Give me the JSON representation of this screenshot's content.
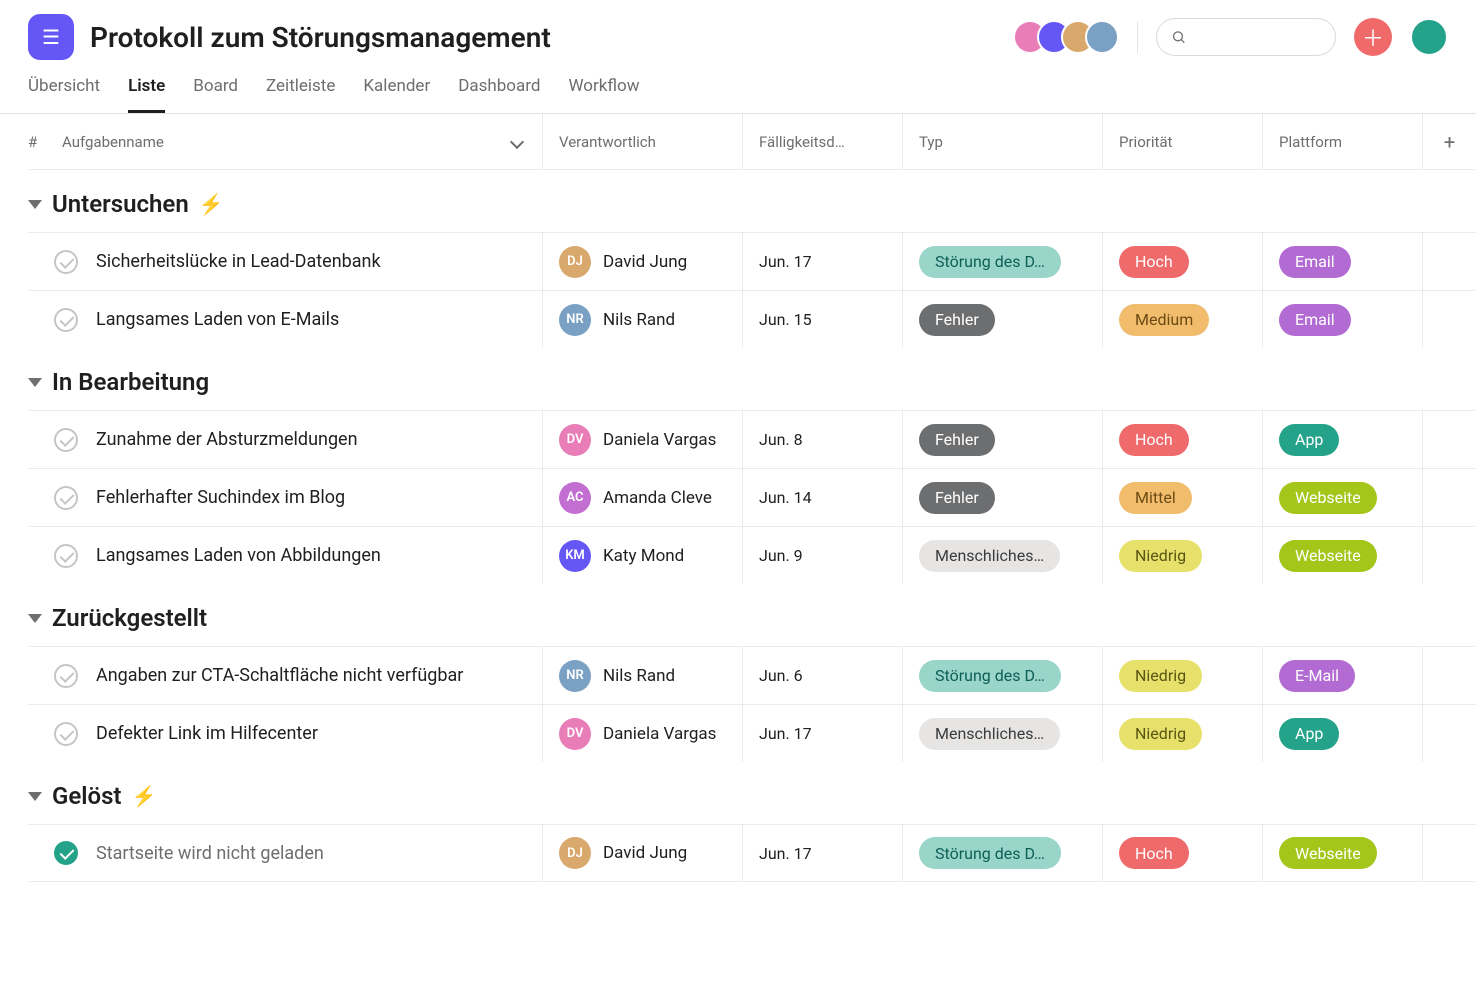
{
  "header": {
    "title": "Protokoll zum Störungsmanagement",
    "search_placeholder": ""
  },
  "tabs": [
    {
      "label": "Übersicht",
      "active": false
    },
    {
      "label": "Liste",
      "active": true
    },
    {
      "label": "Board",
      "active": false
    },
    {
      "label": "Zeitleiste",
      "active": false
    },
    {
      "label": "Kalender",
      "active": false
    },
    {
      "label": "Dashboard",
      "active": false
    },
    {
      "label": "Workflow",
      "active": false
    }
  ],
  "columns": {
    "hash": "#",
    "name": "Aufgabenname",
    "assignee": "Verantwortlich",
    "due": "Fälligkeitsd…",
    "type": "Typ",
    "priority": "Priorität",
    "platform": "Plattform"
  },
  "type_colors": {
    "Störung des D…": "type-stoerung",
    "Fehler": "type-fehler",
    "Menschliches…": "type-mensch"
  },
  "prio_colors": {
    "Hoch": "prio-hoch",
    "Medium": "prio-medium",
    "Mittel": "prio-mittel",
    "Niedrig": "prio-niedrig"
  },
  "platform_colors": {
    "Email": "plat-email",
    "E-Mail": "plat-email",
    "App": "plat-app",
    "Webseite": "plat-webseite"
  },
  "avatar_colors": {
    "David Jung": "av-c",
    "Nils Rand": "av-d",
    "Daniela Vargas": "av-a",
    "Amanda Cleve": "av-f",
    "Katy Mond": "av-b"
  },
  "sections": [
    {
      "title": "Untersuchen",
      "bolt": true,
      "rows": [
        {
          "done": false,
          "name": "Sicherheitslücke in Lead-Datenbank",
          "assignee": "David Jung",
          "due": "Jun. 17",
          "type": "Störung des D…",
          "priority": "Hoch",
          "platform": "Email"
        },
        {
          "done": false,
          "name": "Langsames Laden von E-Mails",
          "assignee": "Nils Rand",
          "due": "Jun. 15",
          "type": "Fehler",
          "priority": "Medium",
          "platform": "Email"
        }
      ]
    },
    {
      "title": "In Bearbeitung",
      "bolt": false,
      "rows": [
        {
          "done": false,
          "name": "Zunahme der Absturzmeldungen",
          "assignee": "Daniela Vargas",
          "due": "Jun. 8",
          "type": "Fehler",
          "priority": "Hoch",
          "platform": "App"
        },
        {
          "done": false,
          "name": "Fehlerhafter Suchindex im Blog",
          "assignee": "Amanda Cleve",
          "due": "Jun. 14",
          "type": "Fehler",
          "priority": "Mittel",
          "platform": "Webseite"
        },
        {
          "done": false,
          "name": "Langsames Laden von Abbildungen",
          "assignee": "Katy Mond",
          "due": "Jun. 9",
          "type": "Menschliches…",
          "priority": "Niedrig",
          "platform": "Webseite"
        }
      ]
    },
    {
      "title": "Zurückgestellt",
      "bolt": false,
      "rows": [
        {
          "done": false,
          "name": "Angaben zur CTA-Schaltfläche nicht verfügbar",
          "assignee": "Nils Rand",
          "due": "Jun. 6",
          "type": "Störung des D…",
          "priority": "Niedrig",
          "platform": "E-Mail"
        },
        {
          "done": false,
          "name": "Defekter Link im Hilfecenter",
          "assignee": "Daniela Vargas",
          "due": "Jun. 17",
          "type": "Menschliches…",
          "priority": "Niedrig",
          "platform": "App"
        }
      ]
    },
    {
      "title": "Gelöst",
      "bolt": true,
      "rows": [
        {
          "done": true,
          "name": "Startseite wird nicht geladen",
          "assignee": "David Jung",
          "due": "Jun. 17",
          "type": "Störung des D…",
          "priority": "Hoch",
          "platform": "Webseite"
        }
      ]
    }
  ]
}
